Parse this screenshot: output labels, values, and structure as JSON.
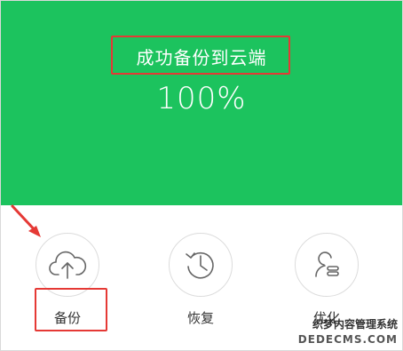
{
  "header": {
    "status": "成功备份到云端",
    "progress_text": "100%",
    "progress_value": 100
  },
  "actions": [
    {
      "label": "备份",
      "icon": "cloud-upload-icon"
    },
    {
      "label": "恢复",
      "icon": "clock-restore-icon"
    },
    {
      "label": "优化",
      "icon": "user-optimize-icon"
    }
  ],
  "watermark": {
    "line1": "织梦内容管理系统",
    "line2": "DEDECMS.COM"
  },
  "colors": {
    "brand_green": "#1cc35e",
    "highlight_red": "#e53935"
  }
}
